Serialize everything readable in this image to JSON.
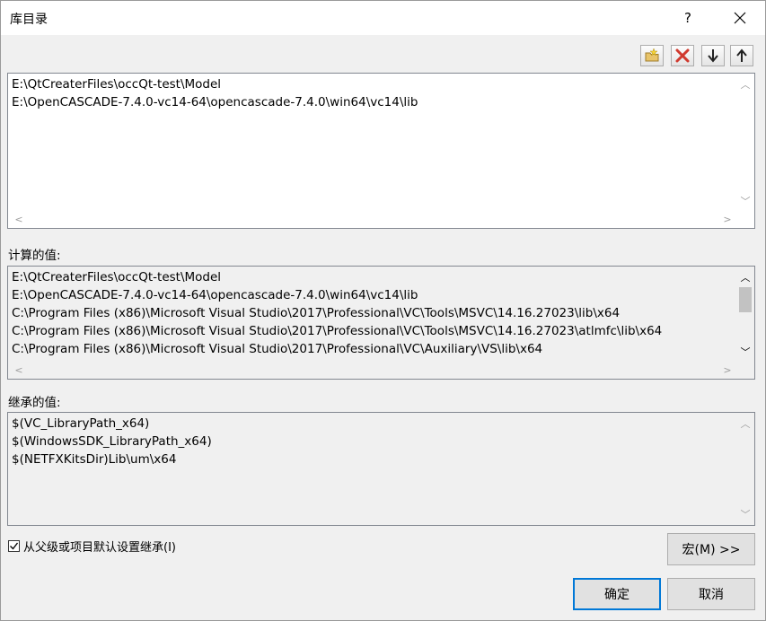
{
  "window": {
    "title": "库目录",
    "help_label": "?"
  },
  "directories": {
    "lines": [
      "E:\\QtCreaterFiles\\occQt-test\\Model",
      "E:\\OpenCASCADE-7.4.0-vc14-64\\opencascade-7.4.0\\win64\\vc14\\lib"
    ]
  },
  "evaluated": {
    "label": "计算的值:",
    "lines": [
      "E:\\QtCreaterFiles\\occQt-test\\Model",
      "E:\\OpenCASCADE-7.4.0-vc14-64\\opencascade-7.4.0\\win64\\vc14\\lib",
      "C:\\Program Files (x86)\\Microsoft Visual Studio\\2017\\Professional\\VC\\Tools\\MSVC\\14.16.27023\\lib\\x64",
      "C:\\Program Files (x86)\\Microsoft Visual Studio\\2017\\Professional\\VC\\Tools\\MSVC\\14.16.27023\\atlmfc\\lib\\x64",
      "C:\\Program Files (x86)\\Microsoft Visual Studio\\2017\\Professional\\VC\\Auxiliary\\VS\\lib\\x64"
    ]
  },
  "inherited": {
    "label": "继承的值:",
    "lines": [
      "$(VC_LibraryPath_x64)",
      "$(WindowsSDK_LibraryPath_x64)",
      "$(NETFXKitsDir)Lib\\um\\x64"
    ]
  },
  "options": {
    "inherit_label": "从父级或项目默认设置继承(I)",
    "inherit_checked": true
  },
  "buttons": {
    "macros": "宏(M) >>",
    "ok": "确定",
    "cancel": "取消"
  },
  "colors": {
    "accent": "#0078d7",
    "delete_red": "#d03a2f"
  }
}
